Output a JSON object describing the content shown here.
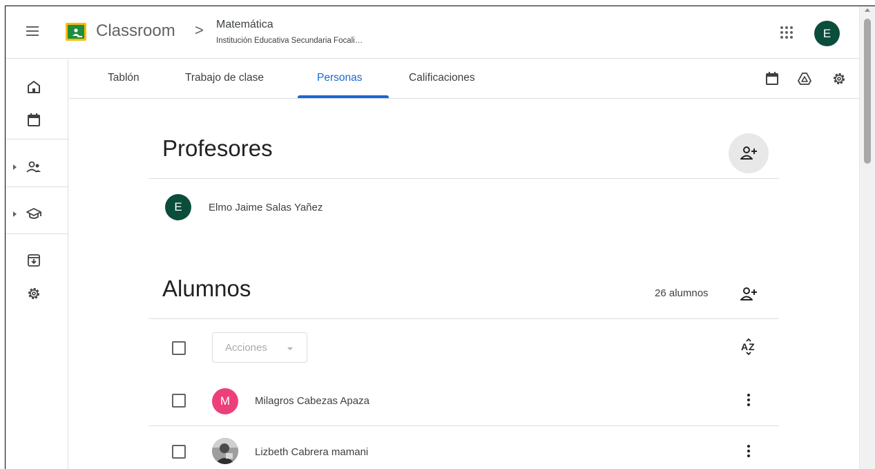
{
  "app": {
    "title": "Classroom",
    "breadcrumb_separator": ">",
    "class_name": "Matemática",
    "class_subtitle": "Institución Educativa Secundaria Focali…",
    "account_initial": "E",
    "icons": {
      "menu": "menu-icon",
      "logo": "classroom-logo",
      "apps": "apps-grid-icon"
    }
  },
  "sidebar": {
    "icons": [
      "home-icon",
      "calendar-icon",
      "people-icon",
      "school-icon",
      "archive-icon",
      "settings-icon"
    ]
  },
  "tabs": [
    {
      "label": "Tablón",
      "active": false
    },
    {
      "label": "Trabajo de clase",
      "active": false
    },
    {
      "label": "Personas",
      "active": true
    },
    {
      "label": "Calificaciones",
      "active": false
    }
  ],
  "tab_tools": [
    "calendar-icon",
    "drive-icon",
    "settings-icon"
  ],
  "teachers": {
    "title": "Profesores",
    "list": [
      {
        "initial": "E",
        "name": "Elmo Jaime Salas Yañez",
        "color": "#0b4d3b"
      }
    ]
  },
  "students": {
    "title": "Alumnos",
    "count_label": "26 alumnos",
    "actions_label": "Acciones",
    "list": [
      {
        "initial": "M",
        "name": "Milagros Cabezas Apaza",
        "color": "#ec407a",
        "photo": false
      },
      {
        "initial": "",
        "name": "Lizbeth Cabrera mamani",
        "color": "#8a8a8a",
        "photo": true
      }
    ]
  },
  "colors": {
    "accent": "#1967d2",
    "teacher_avatar": "#0b4d3b",
    "student_avatar_m": "#ec407a",
    "logo_green": "#1e8e3e",
    "logo_yellow": "#fbbc04"
  }
}
